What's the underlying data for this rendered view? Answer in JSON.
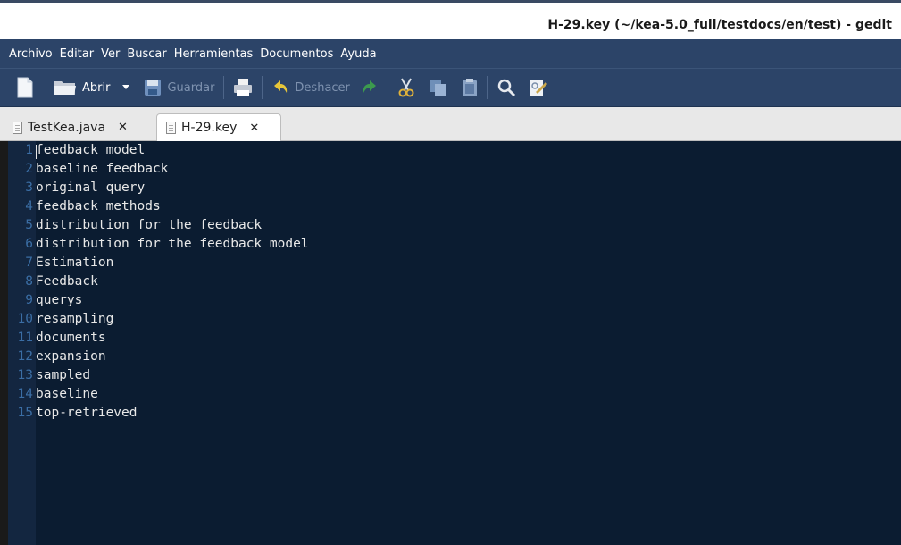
{
  "window": {
    "title": "H-29.key (~/kea-5.0_full/testdocs/en/test) - gedit"
  },
  "menu": [
    "Archivo",
    "Editar",
    "Ver",
    "Buscar",
    "Herramientas",
    "Documentos",
    "Ayuda"
  ],
  "toolbar": {
    "new_icon": "new-document-icon",
    "open_label": "Abrir",
    "save_label": "Guardar",
    "print_icon": "print-icon",
    "undo_label": "Deshacer",
    "redo_icon": "redo-icon",
    "cut_icon": "cut-icon",
    "copy_icon": "copy-icon",
    "paste_icon": "paste-icon",
    "find_icon": "search-icon",
    "replace_icon": "find-replace-icon"
  },
  "tabs": [
    {
      "label": "TestKea.java",
      "active": false
    },
    {
      "label": "H-29.key",
      "active": true
    }
  ],
  "editor": {
    "lines": [
      {
        "num": "1",
        "text": "feedback model"
      },
      {
        "num": "2",
        "text": "baseline feedback"
      },
      {
        "num": "3",
        "text": "original query"
      },
      {
        "num": "4",
        "text": "feedback methods"
      },
      {
        "num": "5",
        "text": "distribution for the feedback"
      },
      {
        "num": "6",
        "text": "distribution for the feedback model"
      },
      {
        "num": "7",
        "text": "Estimation"
      },
      {
        "num": "8",
        "text": "Feedback"
      },
      {
        "num": "9",
        "text": "querys"
      },
      {
        "num": "10",
        "text": "resampling"
      },
      {
        "num": "11",
        "text": "documents"
      },
      {
        "num": "12",
        "text": "expansion"
      },
      {
        "num": "13",
        "text": "sampled"
      },
      {
        "num": "14",
        "text": "baseline"
      },
      {
        "num": "15",
        "text": "top-retrieved"
      }
    ]
  },
  "colors": {
    "menubar": "#2c4468",
    "editor_bg": "#0b1c31",
    "line_number": "#3b6ea5",
    "text": "#e8e8e8"
  }
}
